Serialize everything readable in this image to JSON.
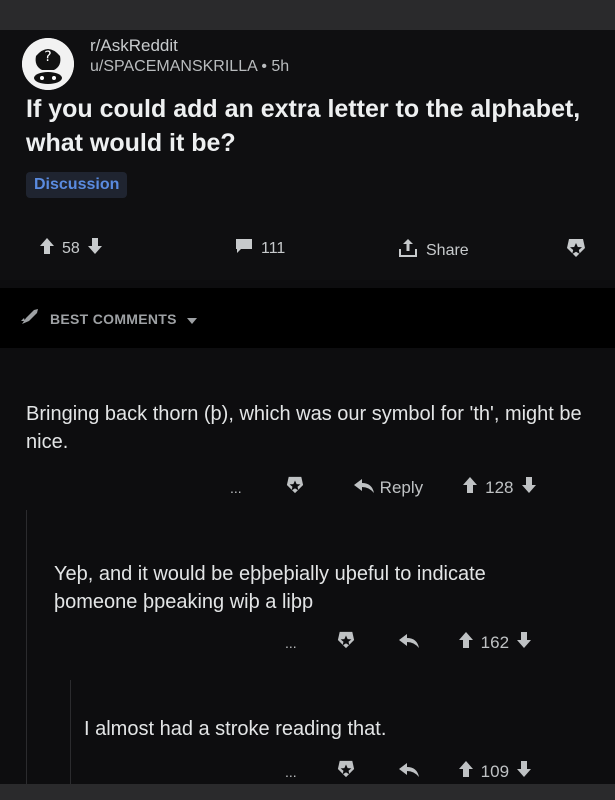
{
  "post": {
    "subreddit": "r/AskReddit",
    "user": "u/SPACEMANSKRILLA",
    "age": "5h",
    "title": "If you could add an extra letter to the alphabet, what would it be?",
    "flair": "Discussion",
    "upvotes": "58",
    "comments": "111",
    "share_label": "Share"
  },
  "sort": {
    "label": "BEST COMMENTS"
  },
  "comments": [
    {
      "text": "Bringing back thorn (þ), which was our symbol for 'th', might be nice.",
      "more": "...",
      "reply_label": "Reply",
      "score": "128"
    },
    {
      "text": "Yeþ, and it would be eþþeþially uþeful to indicate þomeone þpeaking wiþ a liþp",
      "more": "...",
      "score": "162"
    },
    {
      "text": "I almost had a stroke reading that.",
      "more": "...",
      "score": "109"
    }
  ],
  "colors": {
    "accent": "#5a8be0",
    "background": "#0d0d0f"
  },
  "icons": [
    "upvote-icon",
    "downvote-icon",
    "comment-icon",
    "share-icon",
    "award-icon",
    "reply-icon",
    "rocket-icon",
    "caret-down-icon"
  ]
}
